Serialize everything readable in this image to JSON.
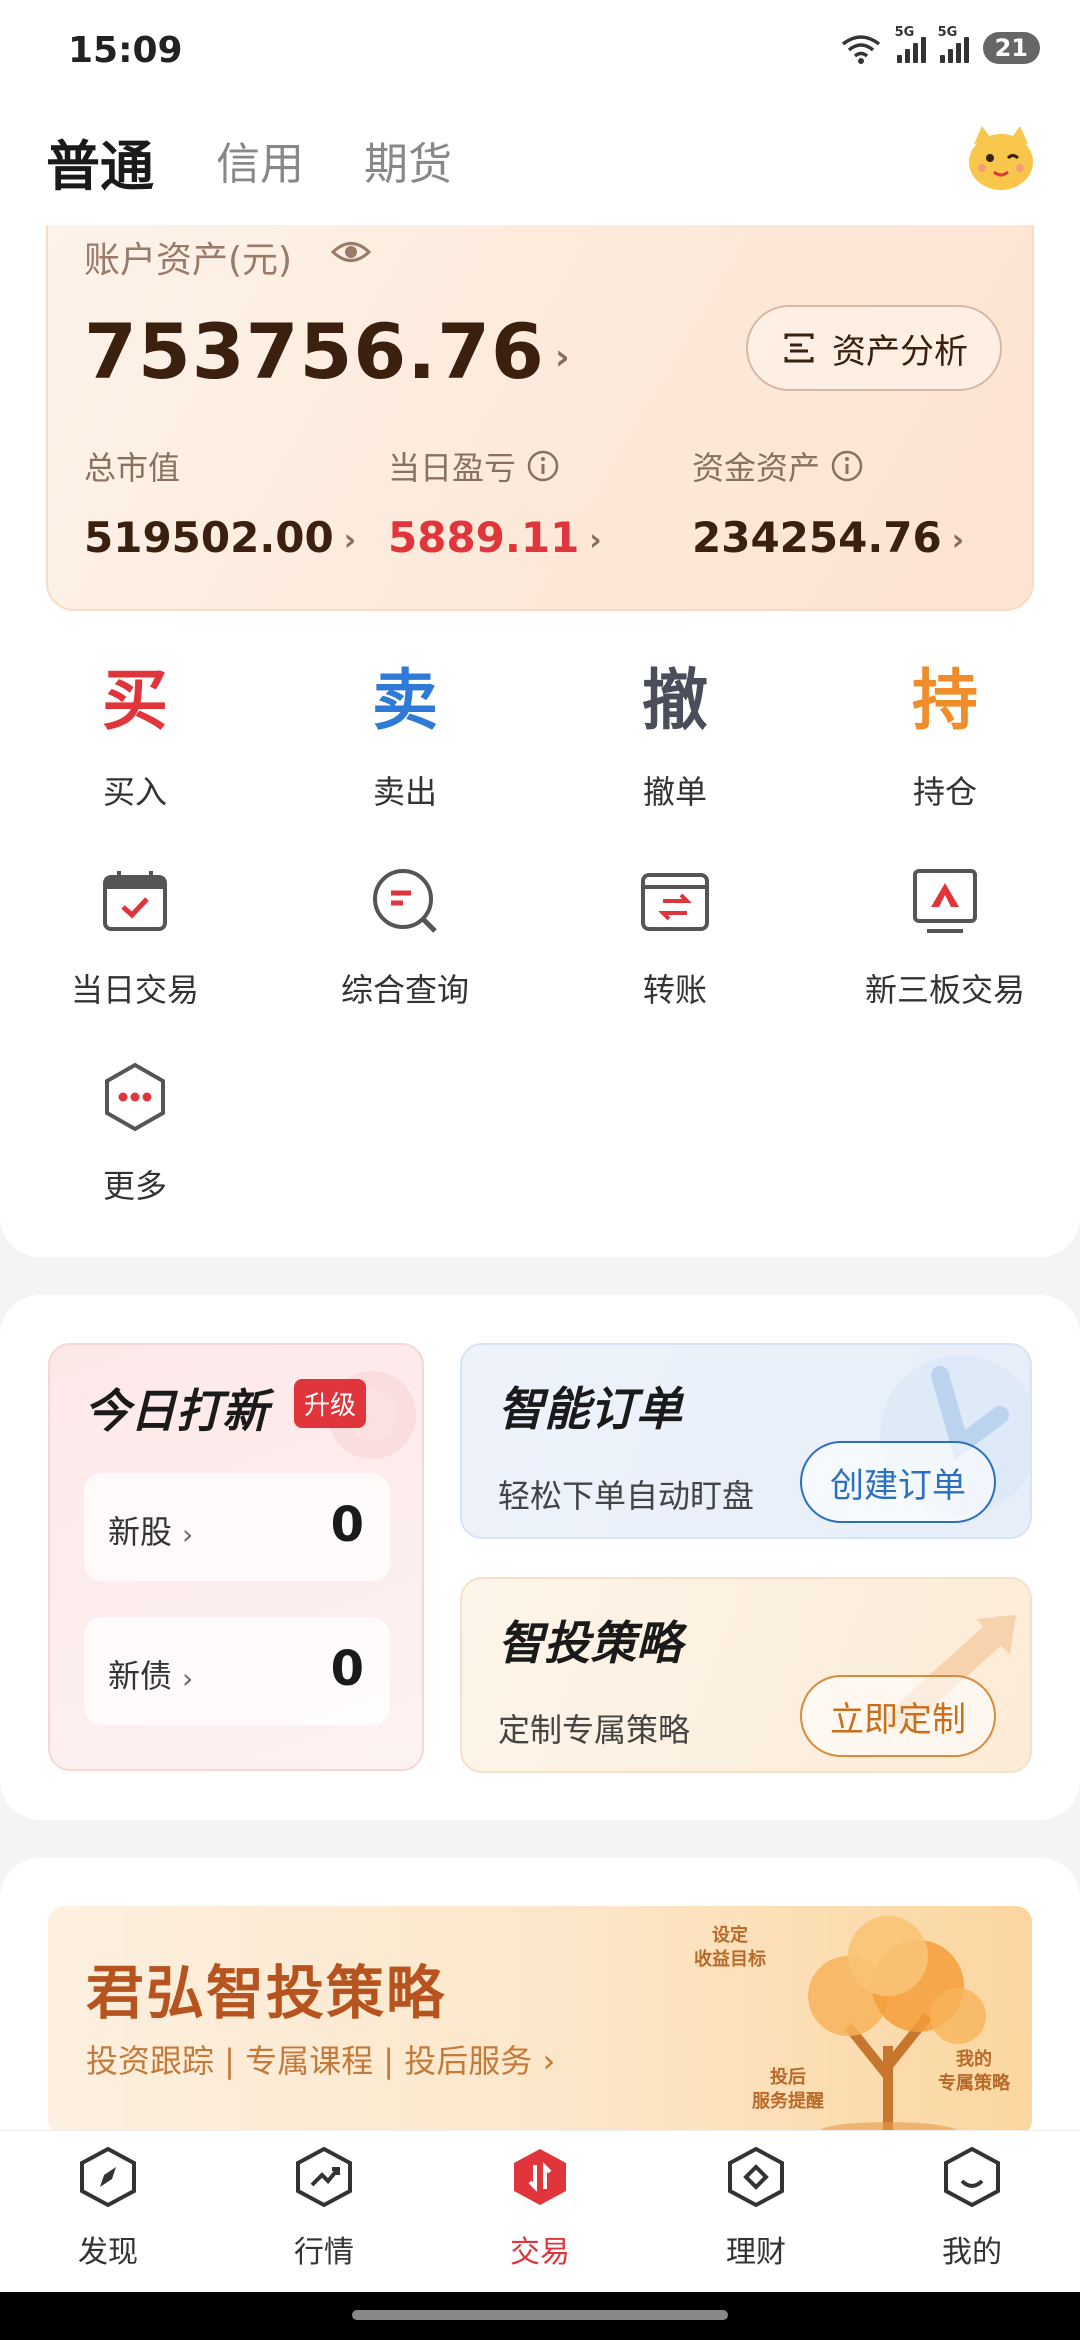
{
  "status_bar": {
    "time": "15:09",
    "battery": "21",
    "sig1": "5G",
    "sig2": "5G",
    "wifi_label": "6"
  },
  "tabs": [
    {
      "label": "普通",
      "active": true
    },
    {
      "label": "信用",
      "active": false
    },
    {
      "label": "期货",
      "active": false
    }
  ],
  "asset": {
    "title": "账户资产(元)",
    "total": "753756.76",
    "analysis_button": "资产分析",
    "market_value_label": "总市值",
    "market_value": "519502.00",
    "daily_pnl_label": "当日盈亏",
    "daily_pnl": "5889.11",
    "cash_label": "资金资产",
    "cash": "234254.76"
  },
  "quick_actions": [
    {
      "glyph": "买",
      "label": "买入",
      "color": "#e0353b"
    },
    {
      "glyph": "卖",
      "label": "卖出",
      "color": "#2f7ad6"
    },
    {
      "glyph": "撤",
      "label": "撤单",
      "color": "#4a4e5a"
    },
    {
      "glyph": "持",
      "label": "持仓",
      "color": "#f08c2a"
    }
  ],
  "tools": [
    {
      "label": "当日交易",
      "icon": "calendar-check-icon"
    },
    {
      "label": "综合查询",
      "icon": "search-query-icon"
    },
    {
      "label": "转账",
      "icon": "transfer-icon"
    },
    {
      "label": "新三板交易",
      "icon": "neeq-board-icon"
    },
    {
      "label": "更多",
      "icon": "more-hexagon-icon"
    }
  ],
  "ipo": {
    "title": "今日打新",
    "badge": "升级",
    "rows": [
      {
        "label": "新股",
        "value": "0"
      },
      {
        "label": "新债",
        "value": "0"
      }
    ]
  },
  "smart_order": {
    "title": "智能订单",
    "subtitle": "轻松下单自动盯盘",
    "button": "创建订单"
  },
  "strategy": {
    "title": "智投策略",
    "subtitle": "定制专属策略",
    "button": "立即定制"
  },
  "banner": {
    "title": "君弘智投策略",
    "subtitle": "投资跟踪 | 专属课程 | 投后服务",
    "tags": [
      "设定\n收益目标",
      "投后\n服务提醒",
      "我的\n专属策略"
    ]
  },
  "nav": [
    {
      "label": "发现",
      "icon": "compass-icon",
      "active": false
    },
    {
      "label": "行情",
      "icon": "trend-icon",
      "active": false
    },
    {
      "label": "交易",
      "icon": "trade-icon",
      "active": true
    },
    {
      "label": "理财",
      "icon": "wealth-icon",
      "active": false
    },
    {
      "label": "我的",
      "icon": "profile-icon",
      "active": false
    }
  ],
  "colors": {
    "accent_red": "#e0353b",
    "accent_blue": "#2b6fc0",
    "accent_orange": "#f08c2a"
  }
}
